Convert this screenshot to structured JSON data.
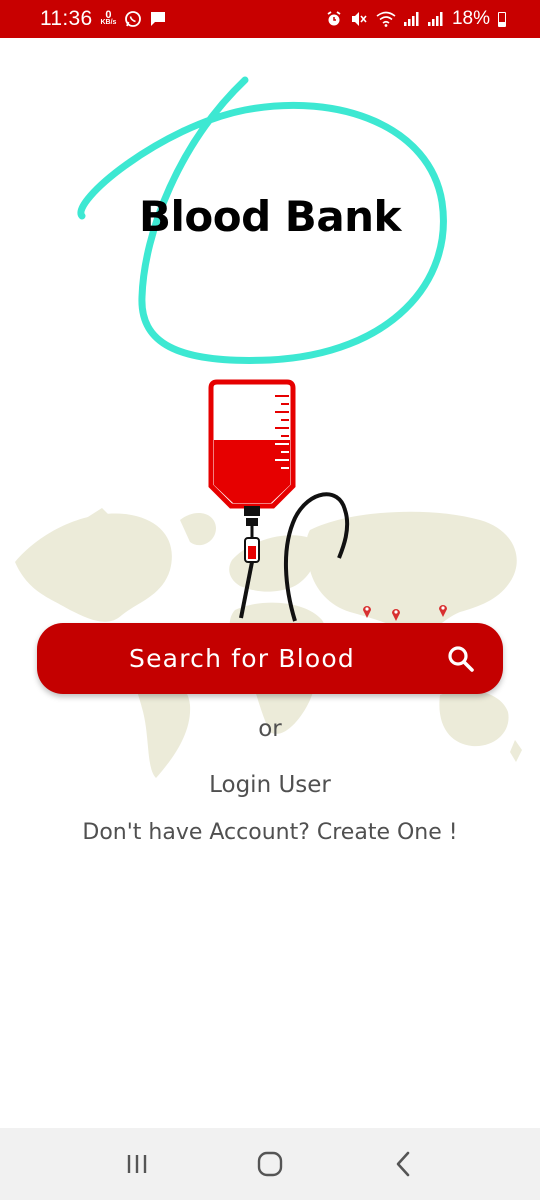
{
  "status_bar": {
    "time": "11:36",
    "net_speed_value": "0",
    "net_speed_unit": "KB/s",
    "battery": "18%",
    "color": "#c80000",
    "icons": [
      "whatsapp-icon",
      "message-icon",
      "alarm-icon",
      "mute-icon",
      "wifi-icon",
      "signal-icon",
      "signal-icon",
      "battery-icon"
    ]
  },
  "app": {
    "title": "Blood Bank",
    "accent_color": "#c40000",
    "annotation_color": "#3de8d2"
  },
  "main": {
    "search_button_label": "Search for Blood",
    "or_label": "or",
    "login_label": "Login User",
    "create_account_label": "Don't have Account? Create One !"
  },
  "nav": {
    "buttons": [
      "recent-apps-icon",
      "home-icon",
      "back-icon"
    ]
  }
}
